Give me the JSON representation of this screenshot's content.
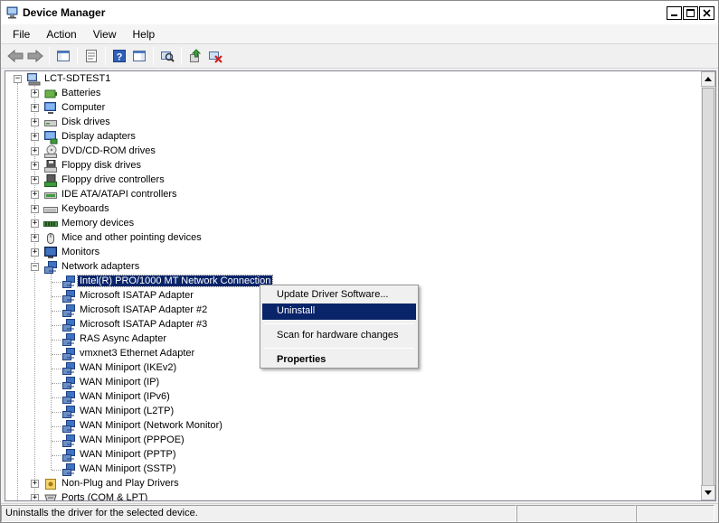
{
  "window": {
    "title": "Device Manager"
  },
  "menubar": {
    "items": [
      "File",
      "Action",
      "View",
      "Help"
    ]
  },
  "tree": {
    "root": "LCT-SDTEST1",
    "categories": [
      "Batteries",
      "Computer",
      "Disk drives",
      "Display adapters",
      "DVD/CD-ROM drives",
      "Floppy disk drives",
      "Floppy drive controllers",
      "IDE ATA/ATAPI controllers",
      "Keyboards",
      "Memory devices",
      "Mice and other pointing devices",
      "Monitors",
      "Network adapters"
    ],
    "network_adapters": [
      "Intel(R) PRO/1000 MT Network Connection",
      "Microsoft ISATAP Adapter",
      "Microsoft ISATAP Adapter #2",
      "Microsoft ISATAP Adapter #3",
      "RAS Async Adapter",
      "vmxnet3 Ethernet Adapter",
      "WAN Miniport (IKEv2)",
      "WAN Miniport (IP)",
      "WAN Miniport (IPv6)",
      "WAN Miniport (L2TP)",
      "WAN Miniport (Network Monitor)",
      "WAN Miniport (PPPOE)",
      "WAN Miniport (PPTP)",
      "WAN Miniport (SSTP)"
    ],
    "after_categories": [
      "Non-Plug and Play Drivers",
      "Ports (COM & LPT)"
    ],
    "selected": "Intel(R) PRO/1000 MT Network Connection"
  },
  "context_menu": {
    "items": [
      "Update Driver Software...",
      "Uninstall",
      "Scan for hardware changes",
      "Properties"
    ],
    "highlighted": "Uninstall",
    "default": "Properties"
  },
  "statusbar": {
    "text": "Uninstalls the driver for the selected device."
  },
  "colors": {
    "selection": "#0a246a",
    "window_bg": "#f0f0f0"
  }
}
